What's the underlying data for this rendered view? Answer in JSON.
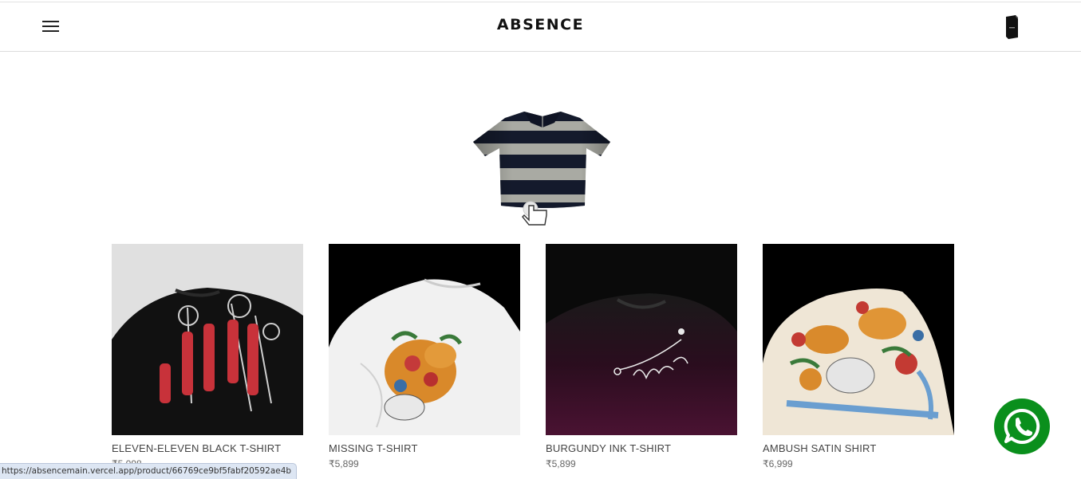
{
  "header": {
    "brand": "ABSENCE",
    "menu_icon": "hamburger-menu-icon",
    "cart_icon": "phone-cart-icon"
  },
  "hero": {
    "image": "striped-polo-3d-model",
    "pointer_icon": "drag-hand-icon"
  },
  "products": [
    {
      "name": "ELEVEN-ELEVEN BLACK T-SHIRT",
      "price": "₹5,098",
      "image": "black-tshirt-red-floral-print"
    },
    {
      "name": "MISSING T-SHIRT",
      "price": "₹5,899",
      "image": "white-tshirt-tiger-floral-print"
    },
    {
      "name": "BURGUNDY INK T-SHIRT",
      "price": "₹5,899",
      "image": "burgundy-tshirt-script-print"
    },
    {
      "name": "AMBUSH SATIN SHIRT",
      "price": "₹6,999",
      "image": "satin-shirt-tiger-floral-print"
    }
  ],
  "status_bar": {
    "url": "https://absencemain.vercel.app/product/66769ce9bf5fabf20592ae4b"
  },
  "floating": {
    "whatsapp_icon": "whatsapp-icon"
  },
  "colors": {
    "accent_whatsapp": "#0a8f1c",
    "header_border": "#dcdcdc",
    "text_dark": "#111111",
    "text_muted": "#666666"
  }
}
